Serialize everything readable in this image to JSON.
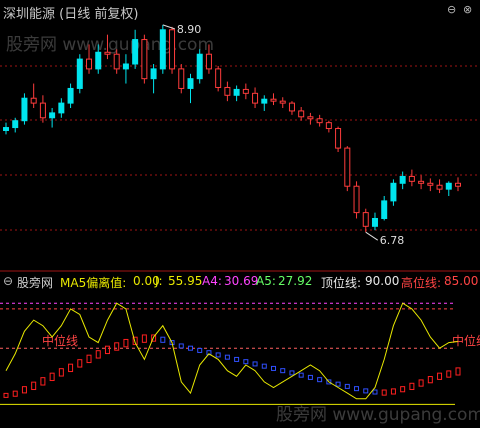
{
  "header": {
    "title": "深圳能源 (日线 前复权)"
  },
  "watermarks": [
    "股旁网 www.gupang.com",
    "股旁网 www.gupang.com"
  ],
  "price_chart": {
    "high_label": "8.90",
    "low_label": "6.78",
    "colors": {
      "up": "#00e5ee",
      "down": "#ff3c3c",
      "bg": "#000000",
      "grid": "#a01414"
    }
  },
  "indicator": {
    "name": "股旁网",
    "ma5_label": "MA5偏离值:",
    "ma5_value": "0.00",
    "j_label": "J:",
    "j_value": "55.95",
    "a4_label": "A4:",
    "a4_value": "30.69",
    "a5_label": "A5:",
    "a5_value": "27.92",
    "top_label": "顶位线:",
    "top_value": "90.00",
    "high_label": "高位线:",
    "high_value": "85.00",
    "mid_left": "中位线",
    "mid_right": "中位线",
    "colors": {
      "j": "#e8e800",
      "a4": "#ff44ff",
      "a5": "#66ff66",
      "top": "#e8e8e8",
      "high": "#ff4444",
      "red_band": "#ff2020",
      "blue_band": "#3050ff"
    }
  },
  "chart_data": {
    "type": "candlestick",
    "candles": [
      [
        7.82,
        7.9,
        7.78,
        7.85
      ],
      [
        7.85,
        7.95,
        7.8,
        7.92
      ],
      [
        7.92,
        8.2,
        7.88,
        8.15
      ],
      [
        8.15,
        8.3,
        8.05,
        8.1
      ],
      [
        8.1,
        8.18,
        7.9,
        7.95
      ],
      [
        7.95,
        8.05,
        7.85,
        8.0
      ],
      [
        8.0,
        8.15,
        7.95,
        8.1
      ],
      [
        8.1,
        8.3,
        8.05,
        8.25
      ],
      [
        8.25,
        8.6,
        8.2,
        8.55
      ],
      [
        8.55,
        8.7,
        8.4,
        8.45
      ],
      [
        8.45,
        8.7,
        8.4,
        8.62
      ],
      [
        8.62,
        8.8,
        8.55,
        8.6
      ],
      [
        8.6,
        8.65,
        8.4,
        8.45
      ],
      [
        8.45,
        8.6,
        8.3,
        8.5
      ],
      [
        8.5,
        8.85,
        8.45,
        8.75
      ],
      [
        8.75,
        8.8,
        8.3,
        8.35
      ],
      [
        8.35,
        8.5,
        8.2,
        8.45
      ],
      [
        8.45,
        8.9,
        8.4,
        8.85
      ],
      [
        8.85,
        8.88,
        8.4,
        8.45
      ],
      [
        8.45,
        8.5,
        8.2,
        8.25
      ],
      [
        8.25,
        8.4,
        8.1,
        8.35
      ],
      [
        8.35,
        8.65,
        8.3,
        8.6
      ],
      [
        8.6,
        8.7,
        8.4,
        8.45
      ],
      [
        8.45,
        8.48,
        8.22,
        8.26
      ],
      [
        8.26,
        8.32,
        8.12,
        8.18
      ],
      [
        8.18,
        8.28,
        8.12,
        8.24
      ],
      [
        8.24,
        8.3,
        8.14,
        8.2
      ],
      [
        8.2,
        8.26,
        8.05,
        8.1
      ],
      [
        8.1,
        8.18,
        8.02,
        8.14
      ],
      [
        8.14,
        8.2,
        8.08,
        8.12
      ],
      [
        8.12,
        8.16,
        8.05,
        8.1
      ],
      [
        8.1,
        8.12,
        7.98,
        8.02
      ],
      [
        8.02,
        8.06,
        7.92,
        7.96
      ],
      [
        7.96,
        8.0,
        7.88,
        7.94
      ],
      [
        7.94,
        7.98,
        7.86,
        7.9
      ],
      [
        7.9,
        7.92,
        7.8,
        7.84
      ],
      [
        7.84,
        7.86,
        7.6,
        7.64
      ],
      [
        7.64,
        7.66,
        7.2,
        7.25
      ],
      [
        7.25,
        7.3,
        6.92,
        6.98
      ],
      [
        6.98,
        7.02,
        6.78,
        6.84
      ],
      [
        6.84,
        6.98,
        6.8,
        6.92
      ],
      [
        6.92,
        7.15,
        6.9,
        7.1
      ],
      [
        7.1,
        7.32,
        7.05,
        7.28
      ],
      [
        7.28,
        7.4,
        7.22,
        7.35
      ],
      [
        7.35,
        7.42,
        7.25,
        7.3
      ],
      [
        7.3,
        7.36,
        7.22,
        7.28
      ],
      [
        7.28,
        7.33,
        7.2,
        7.26
      ],
      [
        7.26,
        7.32,
        7.18,
        7.22
      ],
      [
        7.22,
        7.3,
        7.15,
        7.28
      ],
      [
        7.28,
        7.34,
        7.2,
        7.25
      ]
    ],
    "indicator_series": {
      "J": [
        30,
        45,
        65,
        75,
        70,
        60,
        70,
        85,
        80,
        60,
        55,
        75,
        90,
        85,
        55,
        40,
        60,
        70,
        55,
        20,
        10,
        35,
        45,
        40,
        30,
        25,
        35,
        30,
        20,
        15,
        20,
        25,
        30,
        35,
        30,
        20,
        15,
        10,
        5,
        5,
        15,
        40,
        70,
        90,
        85,
        75,
        60,
        50,
        55,
        55.95
      ],
      "A4": [
        8,
        10,
        14,
        18,
        22,
        26,
        30,
        34,
        38,
        42,
        46,
        50,
        53,
        56,
        58,
        60,
        60,
        58,
        55,
        52,
        50,
        48,
        46,
        44,
        42,
        40,
        38,
        36,
        34,
        32,
        30,
        28,
        26,
        24,
        22,
        20,
        18,
        16,
        14,
        12,
        11,
        11,
        12,
        14,
        17,
        20,
        23,
        26,
        28,
        30.69
      ],
      "A5": [
        8,
        9,
        12,
        15,
        19,
        23,
        27,
        31,
        35,
        39,
        43,
        47,
        50,
        53,
        55,
        57,
        58,
        57,
        55,
        52,
        50,
        48,
        46,
        44,
        42,
        40,
        38,
        36,
        34,
        32,
        30,
        28,
        26,
        24,
        22,
        20,
        18,
        16,
        14,
        12,
        11,
        10,
        11,
        13,
        15,
        18,
        21,
        24,
        26,
        27.92
      ]
    }
  }
}
